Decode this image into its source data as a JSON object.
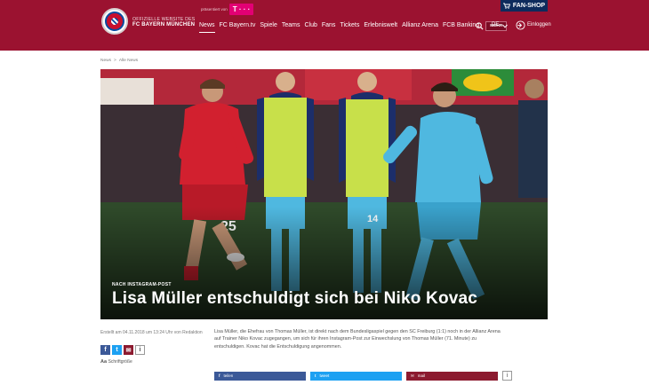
{
  "header": {
    "club_line1": "OFFIZIELLE WEBSITE DES",
    "club_line2": "FC BAYERN MÜNCHEN",
    "sponsor_text": "präsentiert von",
    "sponsor_logo": "T · · ·",
    "nav": [
      "News",
      "FC Bayern.tv",
      "Spiele",
      "Teams",
      "Club",
      "Fans",
      "Tickets",
      "Erlebniswelt",
      "Allianz Arena",
      "FCB Banking"
    ],
    "mehr_label": "MEHR",
    "language": "DE",
    "login_label": "Einloggen",
    "fanshop_label": "FAN-SHOP",
    "brand_color": "#9b1230"
  },
  "breadcrumb": [
    "News",
    ">",
    "Alle News"
  ],
  "hero": {
    "kicker": "NACH INSTAGRAM-POST",
    "headline": "Lisa Müller entschuldigt sich bei Niko Kovac"
  },
  "meta": {
    "date": "Erstellt am 04.11.2018 um 13:24 Uhr von Redaktion",
    "font_size_label": "Schriftgröße",
    "share_icons": [
      "f",
      "t",
      "✉",
      "i"
    ]
  },
  "article": {
    "body": "Lisa Müller, die Ehefrau von Thomas Müller, ist direkt nach dem Bundesligaspiel gegen den SC Freiburg (1:1) noch in der Allianz Arena auf Trainer Niko Kovac zugegangen, um sich für ihren Instagram-Post zur Einwechslung von Thomas Müller (71. Minute) zu entschuldigen. Kovac hat die Entschuldigung angenommen."
  },
  "bottom_share": {
    "facebook": "teilen",
    "twitter": "tweet",
    "mail": "mail",
    "info": "i"
  }
}
